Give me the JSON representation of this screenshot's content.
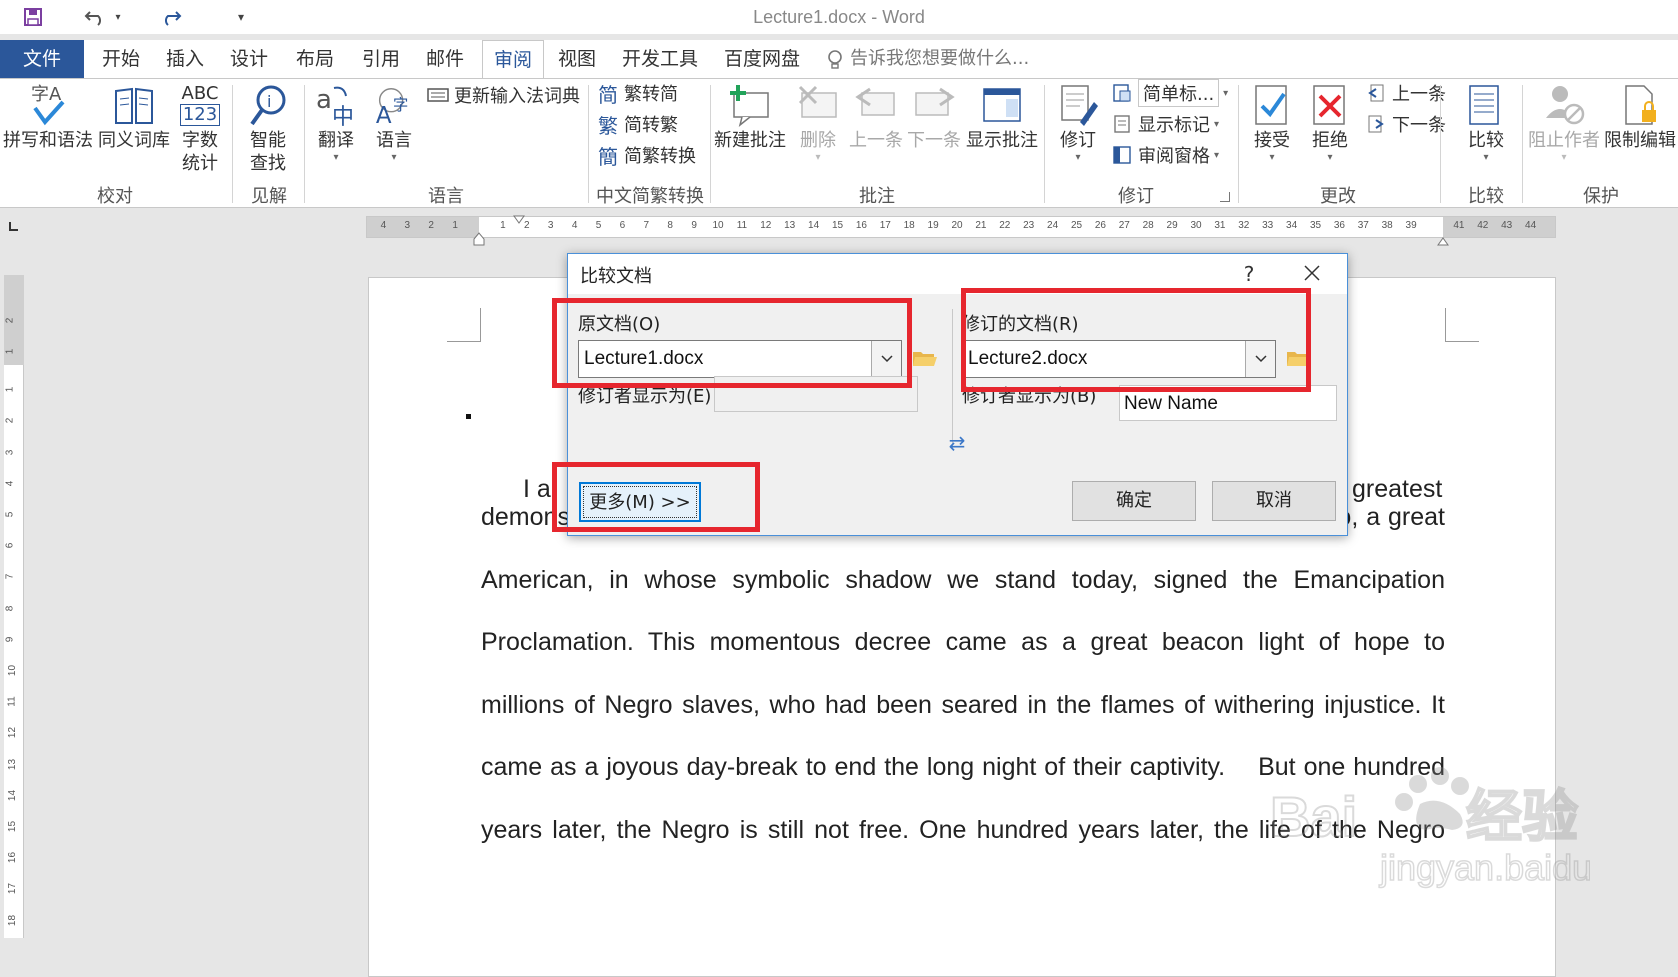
{
  "window": {
    "title": "Lecture1.docx - Word"
  },
  "menu": {
    "file": "文件",
    "tabs": [
      "开始",
      "插入",
      "设计",
      "布局",
      "引用",
      "邮件",
      "审阅",
      "视图",
      "开发工具",
      "百度网盘"
    ],
    "active_tab": "审阅",
    "tell_me": "告诉我您想要做什么..."
  },
  "ribbon": {
    "groups": {
      "proofing": "校对",
      "insights": "见解",
      "language": "语言",
      "chinese": "中文简繁转换",
      "comments": "批注",
      "tracking": "修订",
      "changes": "更改",
      "compare": "比较",
      "protect": "保护"
    },
    "buttons": {
      "spelling": "拼写和语法",
      "thesaurus": "同义词库",
      "wordcount_1": "字数",
      "wordcount_2": "统计",
      "wordcount_icon_top": "ABC",
      "wordcount_icon_bottom": "123",
      "smart_lookup_1": "智能",
      "smart_lookup_2": "查找",
      "translate": "翻译",
      "language": "语言",
      "update_ime": "更新输入法词典",
      "to_simplified": "繁转简",
      "to_traditional": "简转繁",
      "convert": "简繁转换",
      "new_comment": "新建批注",
      "delete": "删除",
      "previous": "上一条",
      "next": "下一条",
      "show_comments": "显示批注",
      "track_changes": "修订",
      "simple_markup": "简单标...",
      "show_markup": "显示标记",
      "reviewing_pane": "审阅窗格",
      "accept": "接受",
      "reject": "拒绝",
      "prev_change": "上一条",
      "next_change": "下一条",
      "compare": "比较",
      "block_authors": "阻止作者",
      "restrict_editing": "限制编辑"
    }
  },
  "ruler": {
    "left_numbers": [
      "4",
      "3",
      "2",
      "1"
    ],
    "numbers": [
      "1",
      "2",
      "3",
      "4",
      "5",
      "6",
      "7",
      "8",
      "9",
      "10",
      "11",
      "12",
      "13",
      "14",
      "15",
      "16",
      "17",
      "18",
      "19",
      "20",
      "21",
      "22",
      "23",
      "24",
      "25",
      "26",
      "27",
      "28",
      "29",
      "30",
      "31",
      "32",
      "33",
      "34",
      "35",
      "36",
      "37",
      "38",
      "39"
    ],
    "right_numbers": [
      "41",
      "42",
      "43",
      "44"
    ],
    "vertical_top": [
      "2",
      "1"
    ],
    "vertical": [
      "1",
      "2",
      "3",
      "4",
      "5",
      "6",
      "7",
      "8",
      "9",
      "10",
      "11",
      "12",
      "13",
      "14",
      "15",
      "16",
      "17",
      "18"
    ]
  },
  "document": {
    "first_line_left": "I a",
    "first_line_right": "greatest",
    "lines": [
      "demonstration for freedom in the history of our nation.  Five score years ago, a great",
      "American, in whose symbolic shadow we stand today, signed the Emancipation",
      "Proclamation. This momentous decree came as a great beacon light of hope to",
      "millions of Negro slaves, who had been seared in the flames of withering injustice. It",
      "came as a joyous day-break to end the long night of their captivity.  But one hundred",
      "years later, the Negro is still not free. One hundred years later, the life of the Negro"
    ]
  },
  "dialog": {
    "title": "比较文档",
    "help": "?",
    "original_label": "原文档(O)",
    "original_value": "Lecture1.docx",
    "revised_label": "修订的文档(R)",
    "revised_value": "Lecture2.docx",
    "label_changes_left": "修订者显示为(E)",
    "label_changes_left_value": "",
    "label_changes_right": "修订者显示为(B)",
    "label_changes_right_value": "New Name",
    "more_button": "更多(M) >>",
    "ok_button": "确定",
    "cancel_button": "取消"
  },
  "colors": {
    "accent": "#2b579a",
    "highlight": "#e6262e",
    "dialog_border": "#4a90d9"
  }
}
